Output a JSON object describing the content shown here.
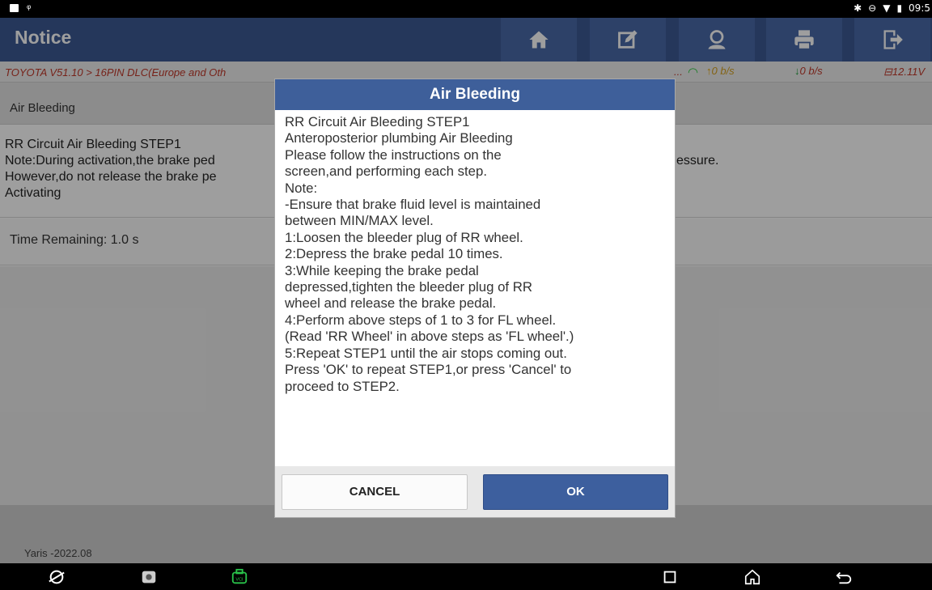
{
  "status_bar": {
    "time": "09:5",
    "left_icons": [
      "image-icon",
      "usb-icon"
    ],
    "right_icons": [
      "bluetooth-icon",
      "dnd-icon",
      "wifi-icon",
      "battery-icon"
    ]
  },
  "header": {
    "title": "Notice",
    "buttons": [
      {
        "name": "home-icon"
      },
      {
        "name": "edit-report-icon"
      },
      {
        "name": "user-support-icon"
      },
      {
        "name": "print-icon"
      },
      {
        "name": "exit-icon"
      }
    ]
  },
  "subheader": {
    "breadcrumb": "TOYOTA V51.10 > 16PIN DLC(Europe and Oth",
    "ellipsis": "...",
    "upload": "0 b/s",
    "download": "0 b/s",
    "voltage": "12.11V"
  },
  "page": {
    "section_title": "Air Bleeding",
    "info_lines": [
      "RR Circuit Air Bleeding STEP1",
      "Note:During activation,the brake ped",
      "However,do not release the brake pe",
      "Activating"
    ],
    "info_tail": "essure.",
    "time_remaining": "Time Remaining: 1.0 s",
    "vehicle": "Yaris -2022.08"
  },
  "dialog": {
    "title": "Air Bleeding",
    "lines": [
      "RR Circuit Air Bleeding STEP1",
      "Anteroposterior plumbing Air Bleeding",
      "Please follow the instructions on the",
      "screen,and performing each step.",
      "Note:",
      "-Ensure that brake fluid level is maintained",
      "between MIN/MAX level.",
      "1:Loosen the bleeder plug of RR wheel.",
      "2:Depress the brake pedal 10 times.",
      "3:While keeping the brake pedal",
      "depressed,tighten the bleeder plug of RR",
      "wheel and release the brake pedal.",
      "4:Perform above steps of 1 to 3 for FL wheel.",
      "(Read 'RR Wheel' in above steps as 'FL wheel'.)",
      "5:Repeat STEP1 until the air stops coming out.",
      "Press 'OK' to repeat STEP1,or press 'Cancel' to",
      "proceed to STEP2."
    ],
    "cancel_label": "CANCEL",
    "ok_label": "OK"
  },
  "navbar": {
    "left_icons": [
      "browser-icon",
      "gallery-icon",
      "vci-icon"
    ],
    "right_icons": [
      "recents-icon",
      "home-nav-icon",
      "back-icon"
    ]
  },
  "colors": {
    "header_blue": "#3c5a93",
    "dialog_blue": "#3e5f9a",
    "breadcrumb_red": "#c0392b",
    "wifi_green": "#2ecc40"
  }
}
